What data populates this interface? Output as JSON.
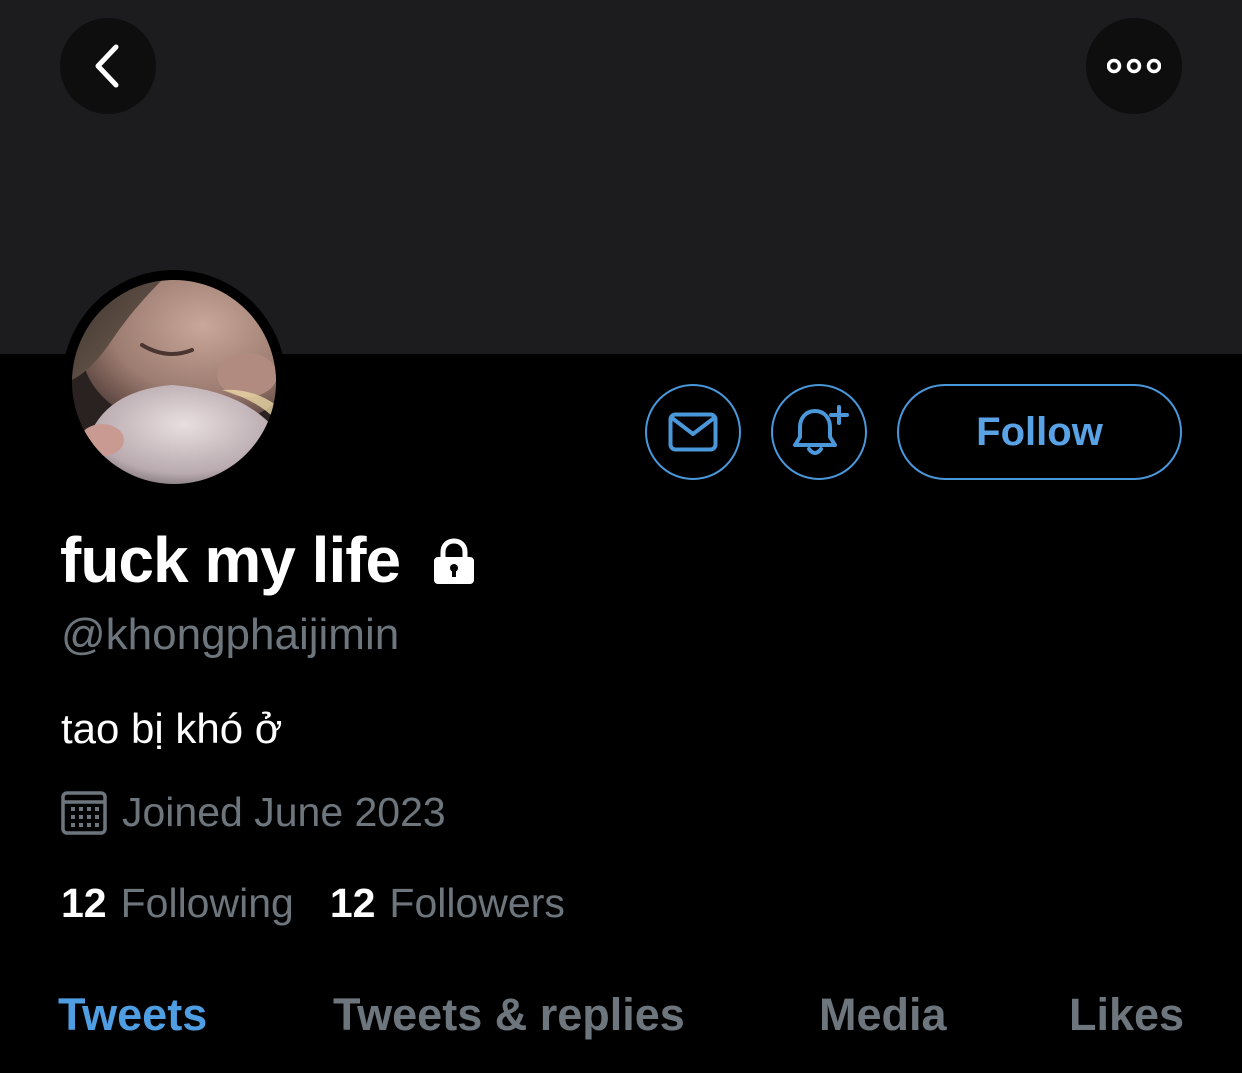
{
  "header": {
    "back_icon": "chevron-left-icon",
    "more_icon": "more-horizontal-icon"
  },
  "profile": {
    "display_name": "fuck my life",
    "protected_icon": "lock-icon",
    "handle": "@khongphaijimin",
    "bio": "tao bị khó ở",
    "joined": "Joined June 2023",
    "joined_icon": "calendar-icon"
  },
  "actions": {
    "message_icon": "envelope-icon",
    "notify_icon": "bell-plus-icon",
    "follow_label": "Follow"
  },
  "stats": {
    "following_count": "12",
    "following_label": "Following",
    "followers_count": "12",
    "followers_label": "Followers"
  },
  "tabs": [
    {
      "label": "Tweets",
      "active": true
    },
    {
      "label": "Tweets & replies",
      "active": false
    },
    {
      "label": "Media",
      "active": false
    },
    {
      "label": "Likes",
      "active": false
    }
  ],
  "colors": {
    "accent": "#4a97da",
    "background": "#000000",
    "banner": "#1c1c1e",
    "secondary_text": "#6e767d",
    "primary_text": "#ffffff"
  }
}
